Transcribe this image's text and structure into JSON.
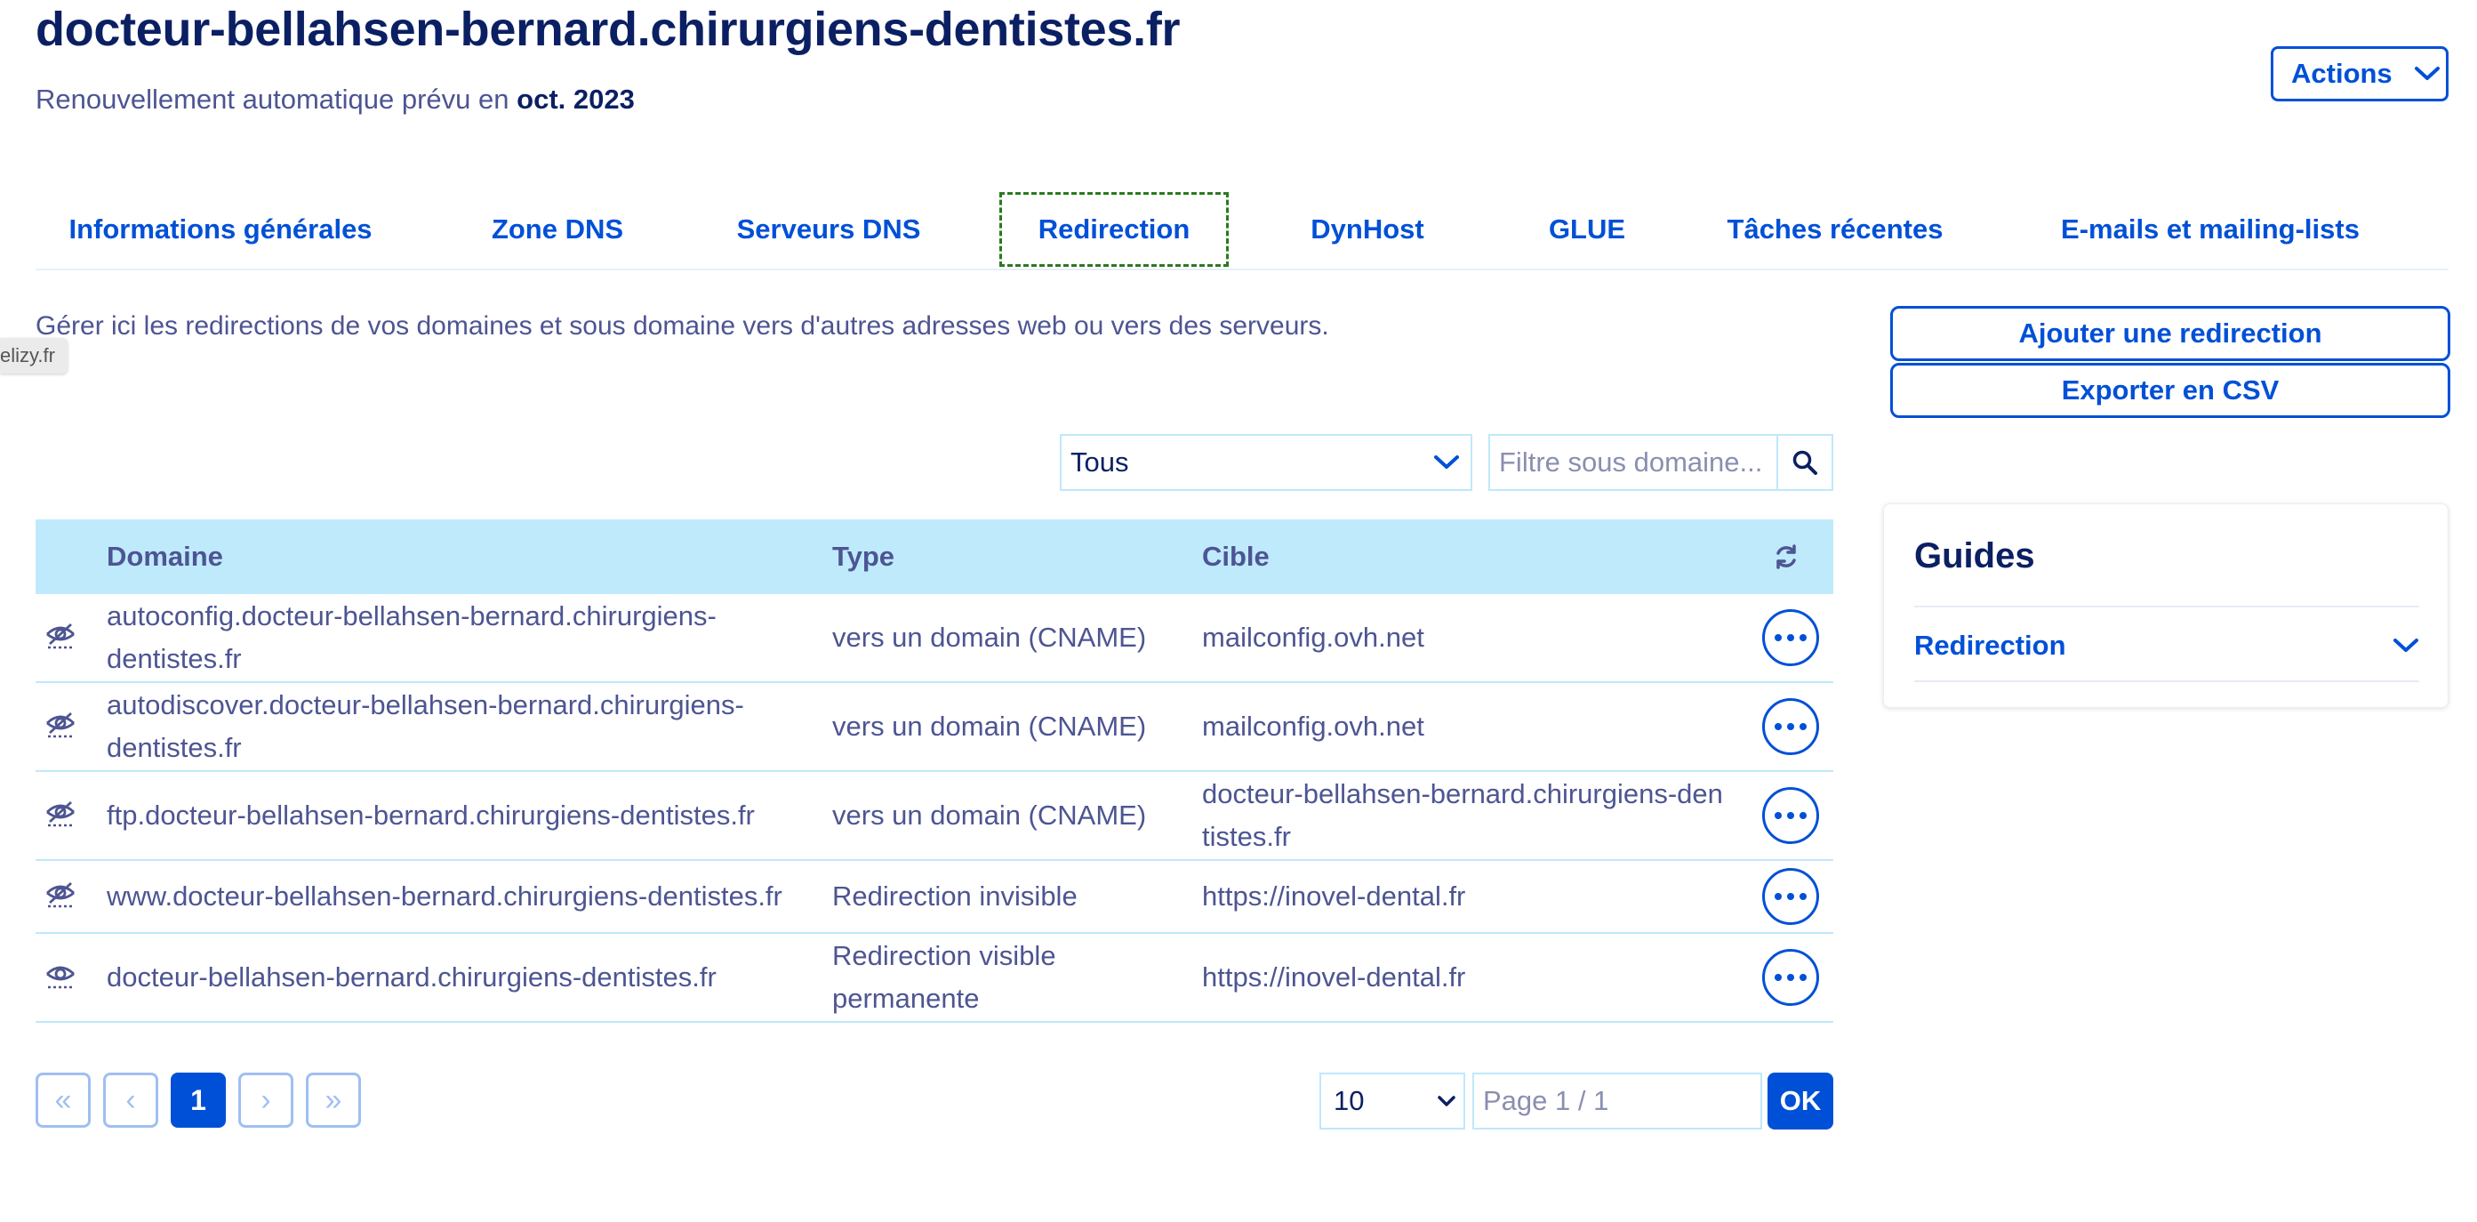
{
  "header": {
    "title": "docteur-bellahsen-bernard.chirurgiens-dentistes.fr",
    "renewal_prefix": "Renouvellement automatique prévu en",
    "renewal_date": "oct. 2023",
    "actions_label": "Actions"
  },
  "tabs": [
    {
      "label": "Informations générales",
      "active": false
    },
    {
      "label": "Zone DNS",
      "active": false
    },
    {
      "label": "Serveurs DNS",
      "active": false
    },
    {
      "label": "Redirection",
      "active": true
    },
    {
      "label": "DynHost",
      "active": false
    },
    {
      "label": "GLUE",
      "active": false
    },
    {
      "label": "Tâches récentes",
      "active": false
    },
    {
      "label": "E-mails et mailing-lists",
      "active": false
    }
  ],
  "description": "Gérer ici les redirections de vos domaines et sous domaine vers d'autres adresses web ou vers des serveurs.",
  "tooltip": "elizy.fr",
  "buttons": {
    "add_redirect": "Ajouter une redirection",
    "export_csv": "Exporter en CSV"
  },
  "filters": {
    "type_selected": "Tous",
    "subdomain_placeholder": "Filtre sous domaine..."
  },
  "table": {
    "headers": {
      "domain": "Domaine",
      "type": "Type",
      "target": "Cible"
    },
    "rows": [
      {
        "icon": "eye-slash-icon",
        "domain": [
          "autoconfig.docteur-bellahsen-bernard.chirurgiens-",
          "dentistes.fr"
        ],
        "type": [
          "vers un domain (CNAME)"
        ],
        "target": [
          "mailconfig.ovh.net"
        ]
      },
      {
        "icon": "eye-slash-icon",
        "domain": [
          "autodiscover.docteur-bellahsen-bernard.chirurgiens-",
          "dentistes.fr"
        ],
        "type": [
          "vers un domain (CNAME)"
        ],
        "target": [
          "mailconfig.ovh.net"
        ]
      },
      {
        "icon": "eye-slash-icon",
        "domain": [
          "ftp.docteur-bellahsen-bernard.chirurgiens-dentistes.fr"
        ],
        "type": [
          "vers un domain (CNAME)"
        ],
        "target": [
          "docteur-bellahsen-bernard.chirurgiens-den",
          "tistes.fr"
        ]
      },
      {
        "icon": "eye-slash-icon",
        "domain": [
          "www.docteur-bellahsen-bernard.chirurgiens-dentistes.fr"
        ],
        "type": [
          "Redirection invisible"
        ],
        "target": [
          "https://inovel-dental.fr"
        ]
      },
      {
        "icon": "eye-icon",
        "domain": [
          "docteur-bellahsen-bernard.chirurgiens-dentistes.fr"
        ],
        "type": [
          "Redirection visible",
          "permanente"
        ],
        "target": [
          "https://inovel-dental.fr"
        ]
      }
    ]
  },
  "pagination": {
    "first": "«",
    "prev": "‹",
    "current": "1",
    "next": "›",
    "last": "»",
    "per_page": "10",
    "page_placeholder": "Page 1 / 1",
    "ok_label": "OK"
  },
  "guides": {
    "title": "Guides",
    "items": [
      "Redirection"
    ]
  },
  "colors": {
    "accent": "#0050d7",
    "title": "#0b1f63",
    "text": "#4d5592",
    "table_header_bg": "#bfeafc",
    "active_tab_border": "#2a7a1f"
  }
}
